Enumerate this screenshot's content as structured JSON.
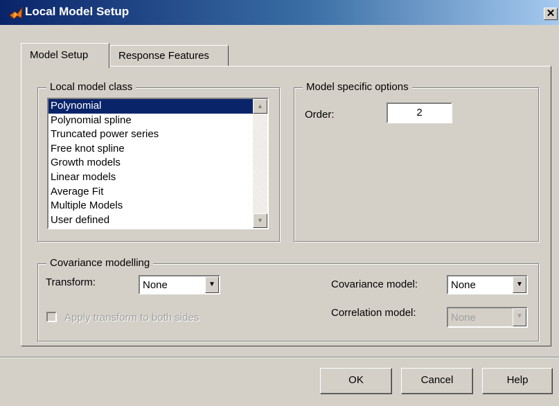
{
  "window": {
    "title": "Local Model Setup",
    "close_glyph": "✕"
  },
  "tabs": [
    {
      "label": "Model Setup",
      "active": true
    },
    {
      "label": "Response Features",
      "active": false
    }
  ],
  "local_model_class": {
    "legend": "Local model class",
    "items": [
      "Polynomial",
      "Polynomial spline",
      "Truncated power series",
      "Free knot spline",
      "Growth models",
      "Linear models",
      "Average Fit",
      "Multiple Models",
      "User defined"
    ],
    "selected": "Polynomial"
  },
  "model_options": {
    "legend": "Model specific options",
    "order_label": "Order:",
    "order_value": "2"
  },
  "covariance": {
    "legend": "Covariance modelling",
    "transform_label": "Transform:",
    "transform_value": "None",
    "covariance_model_label": "Covariance model:",
    "covariance_model_value": "None",
    "correlation_model_label": "Correlation model:",
    "correlation_model_value": "None",
    "apply_transform_label": "Apply transform to both sides",
    "apply_transform_checked": false
  },
  "buttons": {
    "ok": "OK",
    "cancel": "Cancel",
    "help": "Help"
  },
  "icons": {
    "scroll_up": "▲",
    "scroll_down": "▼",
    "dropdown": "▼"
  }
}
